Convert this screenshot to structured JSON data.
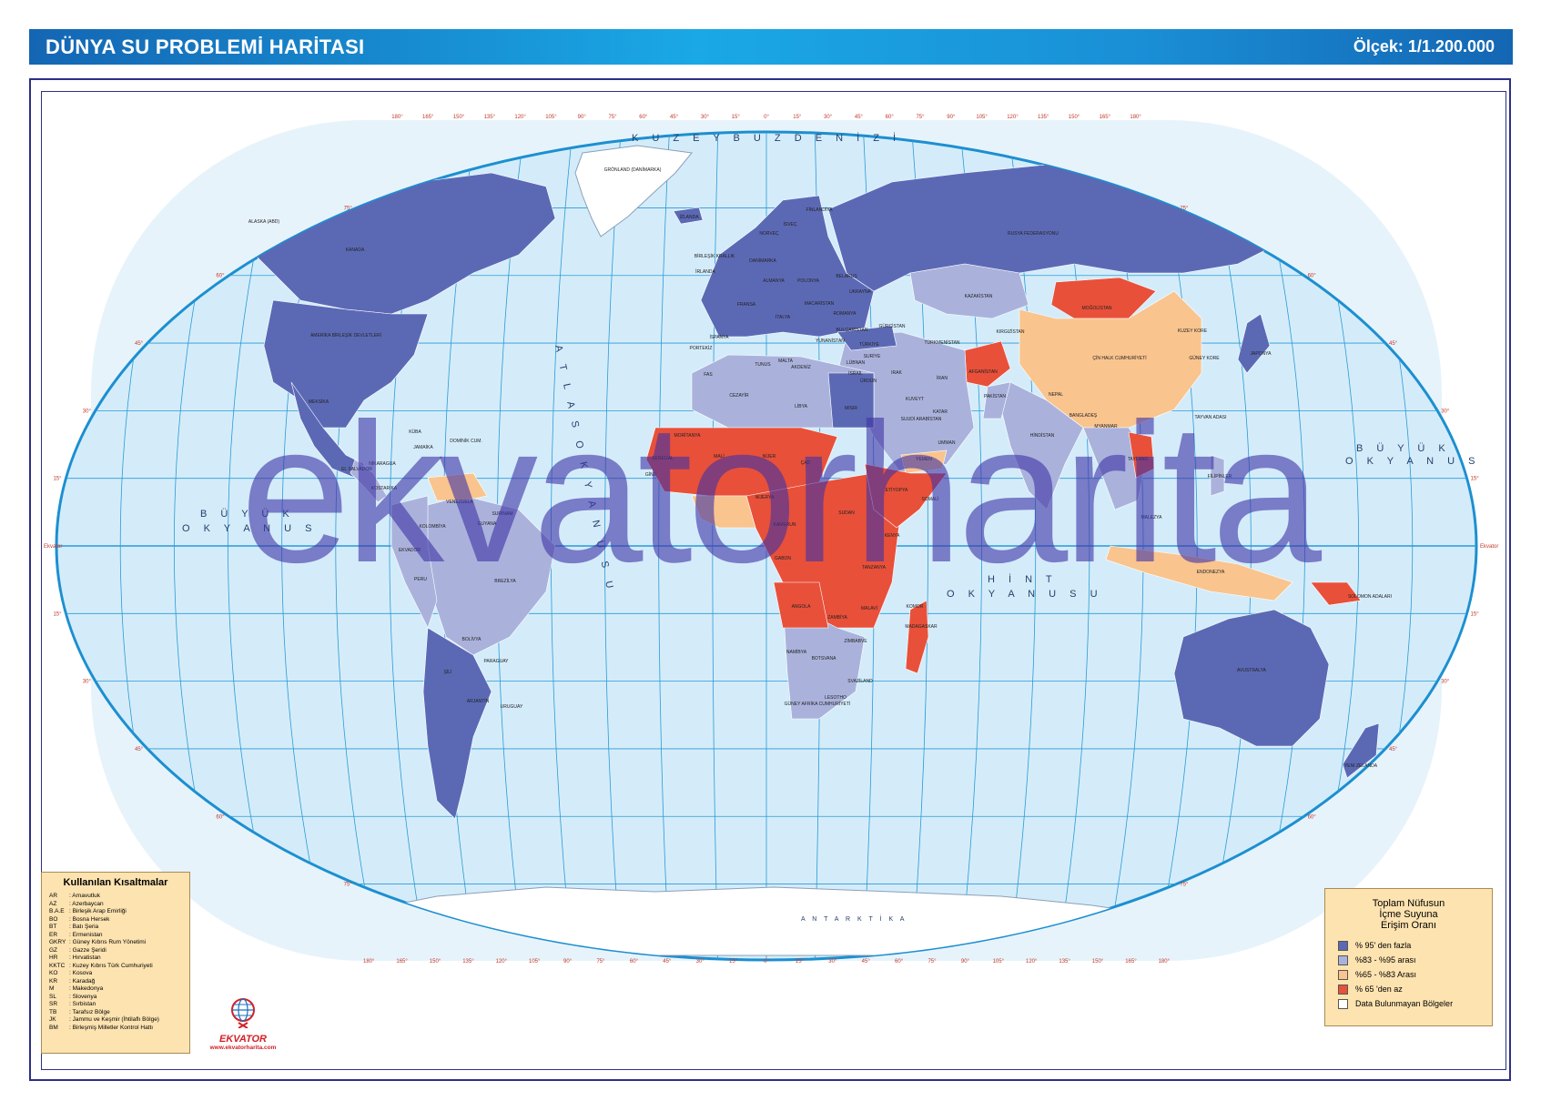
{
  "header": {
    "title": "DÜNYA SU PROBLEMİ HARİTASI",
    "scale": "Ölçek: 1/1.200.000"
  },
  "watermark": "ekvatorharita",
  "oceans": {
    "arctic": "K U Z E Y   B U Z   D E N İ Z İ",
    "atlantic": "A T L A S   O K Y A N U S U",
    "pacific_west_1": "B Ü Y Ü K",
    "pacific_west_2": "O K Y A N U S",
    "pacific_east_1": "B Ü Y Ü K",
    "pacific_east_2": "O K Y A N U S",
    "indian_1": "H İ N T",
    "indian_2": "O K Y A N U S U",
    "antarctica": "A N T A R K T İ K A"
  },
  "countries": [
    "ALASKA (ABD)",
    "KANADA",
    "AMERİKA BİRLEŞİK DEVLETLERİ",
    "MEKSİKA",
    "KÜBA",
    "JAMAİKA",
    "DOMİNİK CUM.",
    "EL SALVADOR",
    "NİKARAGUA",
    "KOSTARİKA",
    "VENEZUELA",
    "GUYANA",
    "SURİNAM",
    "KOLOMBİYA",
    "EKVADOR",
    "PERU",
    "BREZİLYA",
    "BOLİVYA",
    "PARAGUAY",
    "ŞİLİ",
    "ARJANTİN",
    "URUGUAY",
    "GRÖNLAND (DANİMARKA)",
    "İZLANDA",
    "İRLANDA",
    "BİRLEŞİK KRALLIK",
    "NORVEÇ",
    "İSVEÇ",
    "FİNLANDİYA",
    "DANİMARKA",
    "ALMANYA",
    "POLONYA",
    "FRANSA",
    "İSPANYA",
    "PORTEKİZ",
    "İTALYA",
    "MACARİSTAN",
    "ROMANYA",
    "BULGARİSTAN",
    "YUNANİSTAN",
    "TÜRKİYE",
    "UKRAYNA",
    "BELARUS",
    "RUSYA FEDERASYONU",
    "KAZAKİSTAN",
    "MOĞOLİSTAN",
    "ÇİN HALK CUMHURİYETİ",
    "KUZEY KORE",
    "GÜNEY KORE",
    "JAPONYA",
    "GÜRCİSTAN",
    "KIRGIZİSTAN",
    "TÜRKMENİSTAN",
    "AFGANİSTAN",
    "PAKİSTAN",
    "İRAN",
    "IRAK",
    "SURİYE",
    "LÜBNAN",
    "İSRAİL",
    "ÜRDÜN",
    "SUUDİ ARABİSTAN",
    "YEMEN",
    "UMMAN",
    "KATAR",
    "KUVEYT",
    "HİNDİSTAN",
    "NEPAL",
    "BANGLADEŞ",
    "MYANMAR",
    "TAYLAND",
    "TAYVAN ADASI",
    "FİLİPİNLER",
    "MALEZYA",
    "ENDONEZYA",
    "FAS",
    "CEZAYİR",
    "LİBYA",
    "MISIR",
    "TUNUS",
    "MALTA",
    "AKDENİZ",
    "MORİTANYA",
    "MALİ",
    "NİJER",
    "ÇAD",
    "SUDAN",
    "NİJERYA",
    "KAMERUN",
    "GABON",
    "SENEGAL",
    "GİNE",
    "ETİYOPYA",
    "SOMALİ",
    "KENYA",
    "TANZANYA",
    "ANGOLA",
    "ZAMBİYA",
    "ZİMBABVE",
    "MALAVİ",
    "NAMİBYA",
    "BOTSVANA",
    "GÜNEY AFRİKA CUMHURİYETİ",
    "LESOTHO",
    "SVAZİLAND",
    "MADAGASKAR",
    "KOMOR",
    "AVUSTRALYA",
    "YENİ ZELANDA",
    "SOLOMON ADALARI"
  ],
  "abbreviations": {
    "title": "Kullanılan Kısaltmalar",
    "items": [
      {
        "code": "AR",
        "name": ": Arnavutluk"
      },
      {
        "code": "AZ",
        "name": ": Azerbaycan"
      },
      {
        "code": "B.A.E",
        "name": ": Birleşik Arap Emirliği"
      },
      {
        "code": "BO",
        "name": ": Bosna Hersek"
      },
      {
        "code": "BT",
        "name": ": Batı Şeria"
      },
      {
        "code": "ER",
        "name": ": Ermenistan"
      },
      {
        "code": "GKRY",
        "name": ": Güney Kıbrıs Rum Yönetimi"
      },
      {
        "code": "GZ",
        "name": ": Gazze Şeridi"
      },
      {
        "code": "HR",
        "name": ": Hırvatistan"
      },
      {
        "code": "KKTC",
        "name": ": Kuzey Kıbrıs Türk Cumhuriyeti"
      },
      {
        "code": "KO",
        "name": ": Kosova"
      },
      {
        "code": "KR",
        "name": ": Karadağ"
      },
      {
        "code": "M",
        "name": ": Makedonya"
      },
      {
        "code": "SL",
        "name": ": Slovenya"
      },
      {
        "code": "SR",
        "name": ": Sırbistan"
      },
      {
        "code": "TB",
        "name": ": Tarafsız Bölge"
      },
      {
        "code": "JK",
        "name": ": Jammu ve Keşmir (İhtilaflı Bölge)"
      },
      {
        "code": "BM",
        "name": ": Birleşmiş Milletler Kontrol Hattı"
      }
    ]
  },
  "logo": {
    "brand": "EKVATOR",
    "url": "www.ekvatorharita.com"
  },
  "legend": {
    "title_1": "Toplam Nüfusun",
    "title_2": "İçme Suyuna",
    "title_3": "Erişim Oranı",
    "items": [
      {
        "label": "% 95' den fazla",
        "color": "#5b69b5"
      },
      {
        "label": "%83 - %95 arası",
        "color": "#aab2dc"
      },
      {
        "label": "%65 - %83 Arası",
        "color": "#f9c48e"
      },
      {
        "label": "% 65 'den az",
        "color": "#e8503a"
      },
      {
        "label": "Data Bulunmayan Bölgeler",
        "color": "#ffffff"
      }
    ]
  },
  "graticule": {
    "top_longitudes": [
      "180°",
      "165°",
      "150°",
      "135°",
      "120°",
      "105°",
      "90°",
      "75°",
      "60°",
      "45°",
      "30°",
      "15°",
      "0°",
      "15°",
      "30°",
      "45°",
      "60°",
      "75°",
      "90°",
      "105°",
      "120°",
      "135°",
      "150°",
      "165°",
      "180°"
    ],
    "latitudes": [
      "75°",
      "60°",
      "45°",
      "30°",
      "15°",
      "Ekvator",
      "15°",
      "30°",
      "45°",
      "60°",
      "75°"
    ]
  },
  "colors": {
    "ocean": "#d4ecfa",
    "grid": "#2a9ad6",
    "frame": "#2d2f86",
    "header_start": "#1466b3",
    "header_mid": "#1aa8e6",
    "class_95_plus": "#5b69b5",
    "class_83_95": "#aab2dc",
    "class_65_83": "#f9c48e",
    "class_below_65": "#e8503a",
    "no_data": "#ffffff"
  }
}
